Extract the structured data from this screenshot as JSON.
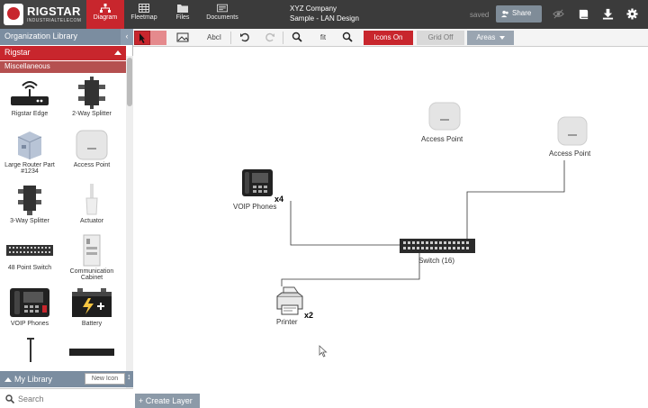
{
  "brand": {
    "name": "RIGSTAR",
    "tagline": "INDUSTRIALTELECOM"
  },
  "nav": [
    {
      "label": "Diagram",
      "icon": "diagram-icon",
      "active": true
    },
    {
      "label": "Fleetmap",
      "icon": "table-icon"
    },
    {
      "label": "Files",
      "icon": "folder-icon"
    },
    {
      "label": "Documents",
      "icon": "documents-icon"
    }
  ],
  "project": {
    "company": "XYZ Company",
    "name": "Sample - LAN Design"
  },
  "status": {
    "saved": "saved"
  },
  "share": {
    "label": "Share"
  },
  "top_icons": [
    "eye-off-icon",
    "book-icon",
    "download-icon",
    "gear-icon"
  ],
  "sidebar": {
    "header": "Organization Library",
    "collapse": "‹",
    "group": "Rigstar",
    "category": "Miscellaneous",
    "items": [
      {
        "label": "Rigstar Edge",
        "icon": "router-icon"
      },
      {
        "label": "2-Way Splitter",
        "icon": "splitter-icon"
      },
      {
        "label": "Large Router Part #1234",
        "icon": "large-router-icon"
      },
      {
        "label": "Access Point",
        "icon": "access-point-icon"
      },
      {
        "label": "3-Way Splitter",
        "icon": "splitter3-icon"
      },
      {
        "label": "Actuator",
        "icon": "actuator-icon"
      },
      {
        "label": "48 Point Switch",
        "icon": "switch-icon"
      },
      {
        "label": "Communication Cabinet",
        "icon": "cabinet-icon"
      },
      {
        "label": "VOIP Phones",
        "icon": "phone-icon"
      },
      {
        "label": "Battery",
        "icon": "battery-icon"
      }
    ],
    "my_library": "My Library",
    "new_icon": "New Icon",
    "search_placeholder": "Search"
  },
  "toolbar": {
    "text_tool": "Abc",
    "fit": "fit",
    "icons_on": "Icons On",
    "grid_off": "Grid Off",
    "areas": "Areas"
  },
  "canvas": {
    "nodes": [
      {
        "label": "Access Point",
        "type": "access-point"
      },
      {
        "label": "Access Point",
        "type": "access-point"
      },
      {
        "label": "VOIP Phones",
        "type": "phone",
        "count": "x4"
      },
      {
        "label": "Switch (16)",
        "type": "switch"
      },
      {
        "label": "Printer",
        "type": "printer",
        "count": "x2"
      }
    ]
  },
  "create_layer": "+ Create Layer",
  "colors": {
    "accent": "#c8262d",
    "topbar": "#3b3b3b",
    "panel": "#7b8da0"
  }
}
